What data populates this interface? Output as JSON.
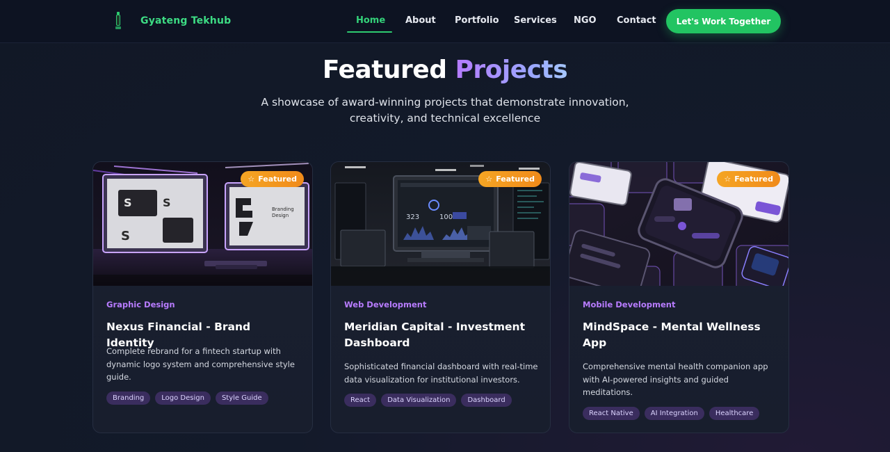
{
  "brand": {
    "name": "Gyateng Tekhub"
  },
  "nav": {
    "links": [
      "Home",
      "About",
      "Portfolio",
      "Services",
      "NGO",
      "Contact"
    ],
    "active": "Home",
    "cta": "Let's Work Together"
  },
  "hero": {
    "title_main": "Featured",
    "title_accent": "Projects",
    "subtitle": "A showcase of award-winning projects that demonstrate innovation, creativity, and technical excellence"
  },
  "cards": [
    {
      "badge": "Featured",
      "category": "Graphic Design",
      "title": "Nexus Financial - Brand Identity",
      "description": "Complete rebrand for a fintech startup with dynamic logo system and comprehensive style guide.",
      "tags": [
        "Branding",
        "Logo Design",
        "Style Guide"
      ],
      "image_text": [
        "Branding",
        "Design"
      ]
    },
    {
      "badge": "Featured",
      "category": "Web Development",
      "title": "Meridian Capital - Investment Dashboard",
      "description": "Sophisticated financial dashboard with real-time data visualization for institutional investors.",
      "tags": [
        "React",
        "Data Visualization",
        "Dashboard"
      ],
      "image_text": [
        "323",
        "100"
      ]
    },
    {
      "badge": "Featured",
      "category": "Mobile Development",
      "title": "MindSpace - Mental Wellness App",
      "description": "Comprehensive mental health companion app with AI-powered insights and guided meditations.",
      "tags": [
        "React Native",
        "AI Integration",
        "Healthcare"
      ],
      "image_text": []
    }
  ],
  "icons": {
    "badge": "star-icon",
    "brand": "tower-logo-icon"
  },
  "colors": {
    "accent_green": "#22c462",
    "accent_purple": "#b87cff",
    "badge_orange": "#f5a524",
    "tag_bg": "#3a2d5e"
  }
}
